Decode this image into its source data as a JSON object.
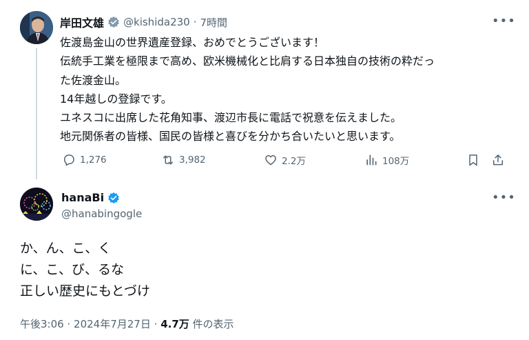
{
  "original_post": {
    "author_name": "岸田文雄",
    "handle": "@kishida230",
    "separator": "·",
    "time": "7時間",
    "verified_color": "#829aab",
    "avatar_icon": "portrait-photo",
    "more_icon": "more-horizontal-icon",
    "more_label": "•••",
    "lines": [
      "佐渡島金山の世界遺産登録、おめでとうございます！",
      "伝統手工業を極限まで高め、欧米機械化と比肩する日本独自の技術の粋だっ",
      "た佐渡金山。",
      "14年越しの登録です。",
      "ユネスコに出席した花角知事、渡辺市長に電話で祝意を伝えました。",
      "地元関係者の皆様、国民の皆様と喜びを分かち合いたいと思います。"
    ],
    "actions": {
      "reply": "1,276",
      "repost": "3,982",
      "like": "2.2万",
      "views": "108万"
    }
  },
  "reply_post": {
    "author_name": "hanaBi",
    "handle": "@hanabingogle",
    "verified_color": "#1d9bf0",
    "avatar_icon": "fireworks-photo",
    "more_label": "•••",
    "lines": [
      "か、ん、こ、く",
      "に、こ、び、るな",
      "正しい歴史にもとづけ"
    ],
    "footer": {
      "time": "午後3:06",
      "separator1": "·",
      "date": "2024年7月27日",
      "separator2": "·",
      "views_count": "4.7万",
      "views_label": "件の表示"
    }
  }
}
